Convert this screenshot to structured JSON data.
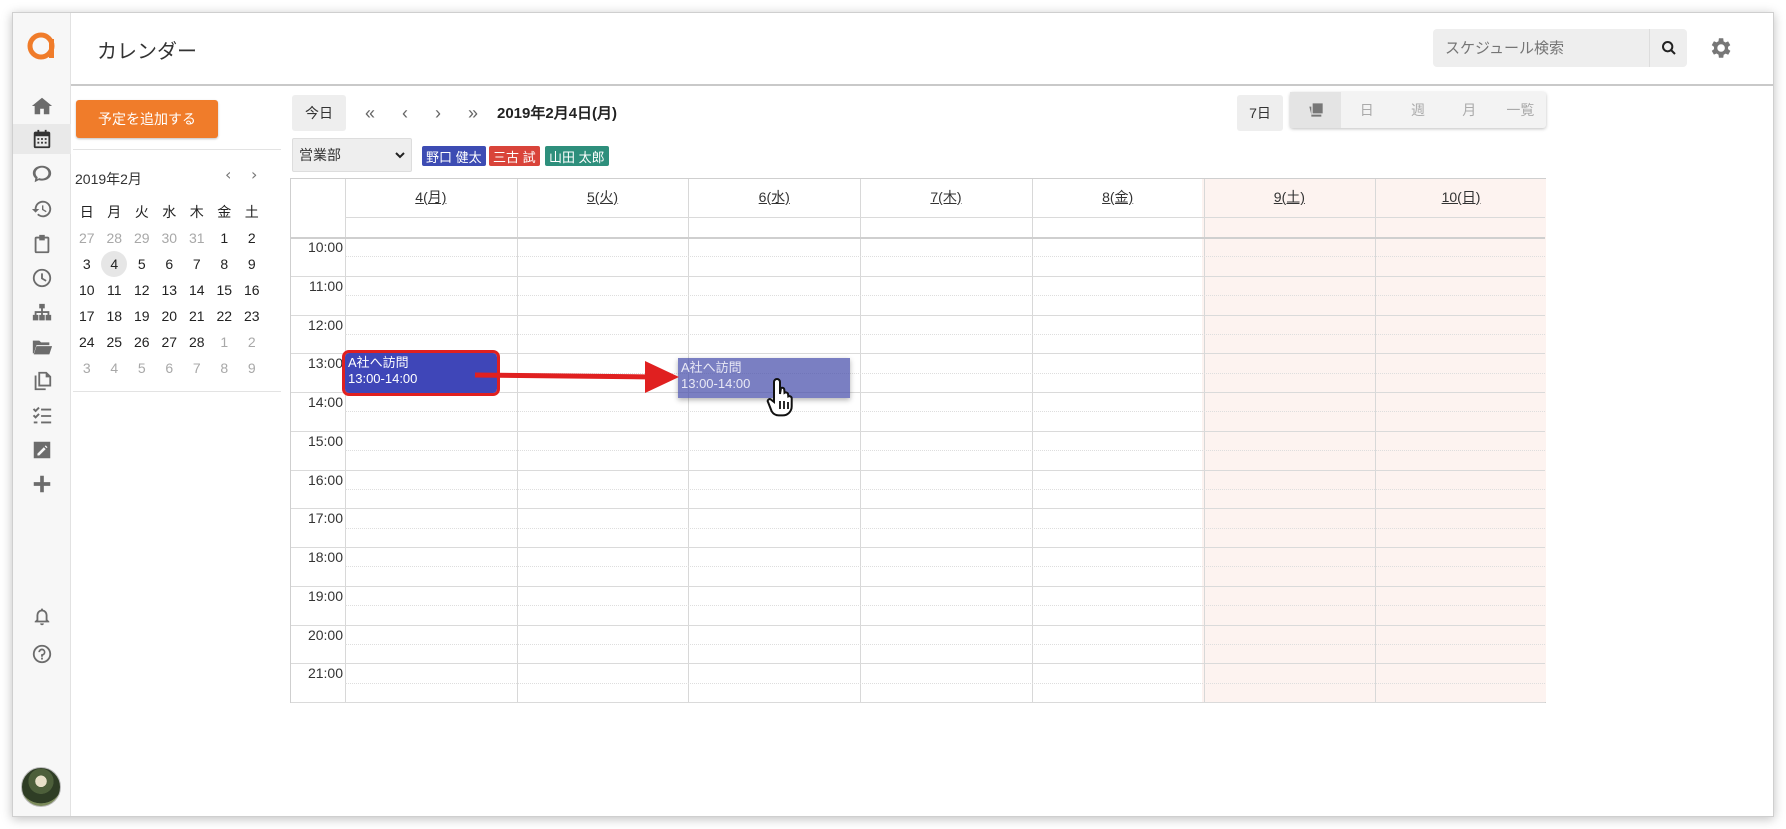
{
  "app": {
    "title": "カレンダー",
    "search_placeholder": "スケジュール検索"
  },
  "rail": {
    "items": [
      "home-icon",
      "calendar-icon",
      "chat-icon",
      "history-icon",
      "clipboard-icon",
      "clock-icon",
      "org-chart-icon",
      "folder-icon",
      "copy-icon",
      "checklist-icon",
      "edit-icon",
      "plus-icon"
    ],
    "bottom": [
      "bell-icon",
      "help-icon"
    ]
  },
  "sidebar": {
    "add_button": "予定を追加する",
    "mini_calendar": {
      "title": "2019年2月",
      "prev": "‹",
      "next": "›",
      "weekdays": [
        "日",
        "月",
        "火",
        "水",
        "木",
        "金",
        "土"
      ],
      "days": [
        [
          "27",
          "28",
          "29",
          "30",
          "31",
          "1",
          "2"
        ],
        [
          "3",
          "4",
          "5",
          "6",
          "7",
          "8",
          "9"
        ],
        [
          "10",
          "11",
          "12",
          "13",
          "14",
          "15",
          "16"
        ],
        [
          "17",
          "18",
          "19",
          "20",
          "21",
          "22",
          "23"
        ],
        [
          "24",
          "25",
          "26",
          "27",
          "28",
          "1",
          "2"
        ],
        [
          "3",
          "4",
          "5",
          "6",
          "7",
          "8",
          "9"
        ]
      ],
      "selected": "4"
    }
  },
  "toolbar": {
    "today": "今日",
    "first": "«",
    "prev": "‹",
    "next": "›",
    "last": "»",
    "date": "2019年2月4日(月)",
    "range": "7日",
    "views": [
      "日",
      "週",
      "月",
      "一覧"
    ],
    "department": "営業部"
  },
  "members": [
    {
      "name": "野口 健太",
      "color": "#3d4cb3"
    },
    {
      "name": "三古 試",
      "color": "#d9443a"
    },
    {
      "name": "山田 太郎",
      "color": "#2e8f7c"
    }
  ],
  "calendar": {
    "days": [
      "4(月)",
      "5(火)",
      "6(水)",
      "7(木)",
      "8(金)",
      "9(土)",
      "10(日)"
    ],
    "times": [
      "10:00",
      "11:00",
      "12:00",
      "13:00",
      "14:00",
      "15:00",
      "16:00",
      "17:00",
      "18:00",
      "19:00",
      "20:00",
      "21:00"
    ]
  },
  "events": {
    "original": {
      "title": "A社へ訪問",
      "time": "13:00-14:00"
    },
    "dragging": {
      "title": "A社へ訪問",
      "time": "13:00-14:00"
    }
  },
  "colors": {
    "accent": "#f07c2a",
    "event": "#3f46b8",
    "highlight": "#e02020",
    "weekend": "#fdf3f0"
  }
}
